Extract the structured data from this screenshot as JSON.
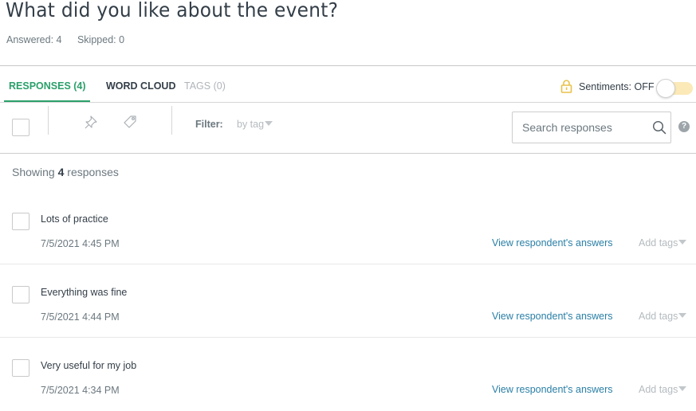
{
  "question": {
    "title": "What did you like about the event?",
    "answered": "Answered: 4",
    "skipped": "Skipped: 0"
  },
  "tabs": [
    {
      "label": "RESPONSES (4)",
      "active": true
    },
    {
      "label": "WORD CLOUD",
      "active": false
    },
    {
      "label": "TAGS (0)",
      "active": false
    }
  ],
  "sentiments": {
    "label": "Sentiments: OFF",
    "enabled": false,
    "lock_icon": "lock-icon",
    "accent_color": "#e8c24a"
  },
  "toolbar": {
    "pin_icon": "pin-icon",
    "tag_icon": "tag-icon",
    "filter_label": "Filter:",
    "filter_value": "by tag",
    "search_placeholder": "Search responses",
    "search_value": "",
    "help_label": "?"
  },
  "summary": {
    "prefix": "Showing",
    "count": "4",
    "suffix": "responses"
  },
  "responses": [
    {
      "text": "Lots of practice",
      "date": "7/5/2021 4:45 PM",
      "link": "View respondent's answers",
      "tags": "Add tags"
    },
    {
      "text": "Everything was fine",
      "date": "7/5/2021 4:44 PM",
      "link": "View respondent's answers",
      "tags": "Add tags"
    },
    {
      "text": "Very useful for my job",
      "date": "7/5/2021 4:34 PM",
      "link": "View respondent's answers",
      "tags": "Add tags"
    }
  ],
  "colors": {
    "primary_green": "#2ba06a",
    "link_blue": "#2a7fa6",
    "text_dark": "#333e48",
    "text_muted": "#6b787f"
  }
}
